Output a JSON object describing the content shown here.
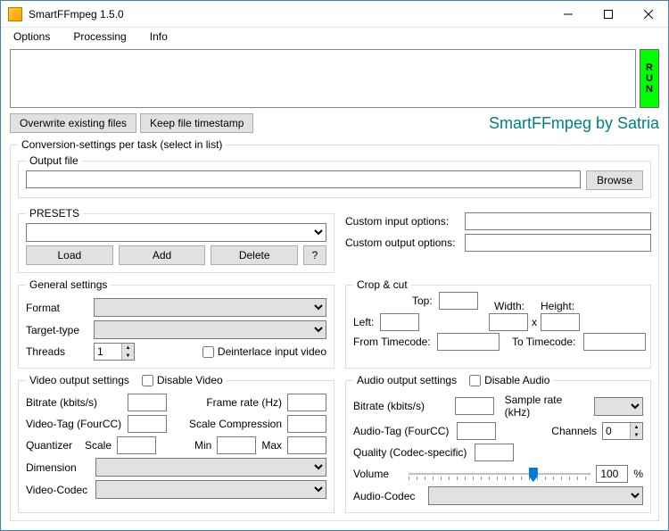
{
  "window": {
    "title": "SmartFFmpeg 1.5.0"
  },
  "menu": {
    "options": "Options",
    "processing": "Processing",
    "info": "Info"
  },
  "run": {
    "r": "R",
    "u": "U",
    "n": "N"
  },
  "toggles": {
    "overwrite": "Overwrite existing files",
    "keep_ts": "Keep file timestamp"
  },
  "brand": "SmartFFmpeg by Satria",
  "settings_legend": "Conversion-settings per task (select in list)",
  "output": {
    "legend": "Output file",
    "value": "",
    "browse": "Browse"
  },
  "presets": {
    "legend": "PRESETS",
    "value": "",
    "load": "Load",
    "add": "Add",
    "delete": "Delete",
    "help": "?"
  },
  "custom": {
    "in_label": "Custom input options:",
    "in_value": "",
    "out_label": "Custom output options:",
    "out_value": ""
  },
  "general": {
    "legend": "General settings",
    "format_label": "Format",
    "format_value": "",
    "target_label": "Target-type",
    "target_value": "",
    "threads_label": "Threads",
    "threads_value": "1",
    "deint_label": "Deinterlace input video"
  },
  "crop": {
    "legend": "Crop & cut",
    "top_label": "Top:",
    "left_label": "Left:",
    "width_label": "Width:",
    "height_label": "Height:",
    "x": "x",
    "from_label": "From Timecode:",
    "to_label": "To Timecode:",
    "top": "",
    "left": "",
    "width": "",
    "height": "",
    "from": "",
    "to": ""
  },
  "video": {
    "legend": "Video output settings",
    "disable": "Disable Video",
    "bitrate_label": "Bitrate (kbits/s)",
    "bitrate": "",
    "framerate_label": "Frame rate (Hz)",
    "framerate": "",
    "tag_label": "Video-Tag (FourCC)",
    "tag": "",
    "scalecomp_label": "Scale Compression",
    "scalecomp": "",
    "quant_label": "Quantizer",
    "scale_label": "Scale",
    "scale": "",
    "min_label": "Min",
    "min": "",
    "max_label": "Max",
    "max": "",
    "dim_label": "Dimension",
    "dim": "",
    "codec_label": "Video-Codec",
    "codec": ""
  },
  "audio": {
    "legend": "Audio output settings",
    "disable": "Disable Audio",
    "bitrate_label": "Bitrate (kbits/s)",
    "bitrate": "",
    "sr_label": "Sample rate (kHz)",
    "sr": "",
    "tag_label": "Audio-Tag (FourCC)",
    "tag": "",
    "channels_label": "Channels",
    "channels": "0",
    "quality_label": "Quality (Codec-specific)",
    "quality": "",
    "volume_label": "Volume",
    "volume": "100",
    "volume_pct": "%",
    "codec_label": "Audio-Codec",
    "codec": ""
  }
}
